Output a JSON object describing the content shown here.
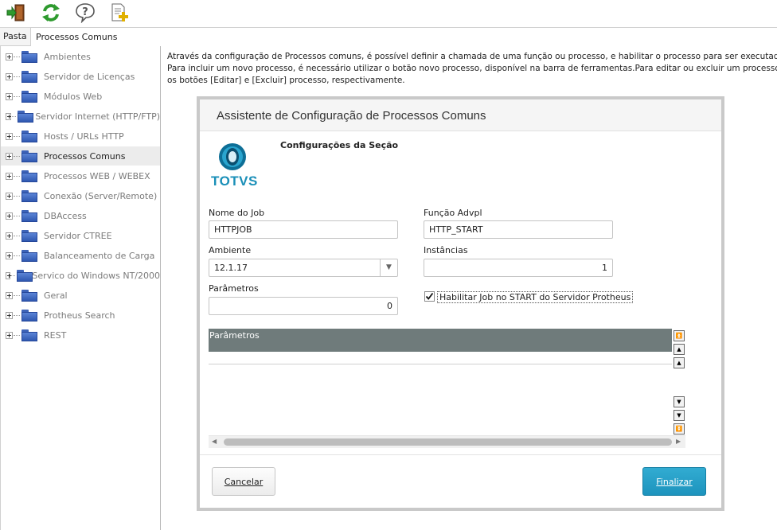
{
  "toolbar": {
    "buttons": [
      {
        "name": "exit-icon",
        "color": "#8b4a1e"
      },
      {
        "name": "refresh-icon",
        "color": "#2e9a2e"
      },
      {
        "name": "help-icon",
        "color": "#555555"
      },
      {
        "name": "new-document-icon",
        "color": "#e0b000"
      }
    ]
  },
  "tabs": {
    "pasta": "Pasta",
    "active": "Processos Comuns"
  },
  "sidebar": {
    "items": [
      {
        "label": "Ambientes",
        "selected": false
      },
      {
        "label": "Servidor de Licenças",
        "selected": false
      },
      {
        "label": "Módulos Web",
        "selected": false
      },
      {
        "label": "Servidor Internet (HTTP/FTP)",
        "selected": false
      },
      {
        "label": "Hosts / URLs HTTP",
        "selected": false
      },
      {
        "label": "Processos Comuns",
        "selected": true
      },
      {
        "label": "Processos WEB / WEBEX",
        "selected": false
      },
      {
        "label": "Conexão (Server/Remote)",
        "selected": false
      },
      {
        "label": "DBAccess",
        "selected": false
      },
      {
        "label": "Servidor CTREE",
        "selected": false
      },
      {
        "label": "Balanceamento de Carga",
        "selected": false
      },
      {
        "label": "Servico do Windows NT/2000",
        "selected": false
      },
      {
        "label": "Geral",
        "selected": false
      },
      {
        "label": "Protheus Search",
        "selected": false
      },
      {
        "label": "REST",
        "selected": false
      }
    ]
  },
  "description": {
    "line1": "Através da configuração de Processos comuns, é possível definir a chamada de uma função ou processo, e habilitar o processo para ser executada durante",
    "line2": "Para incluir um novo processo, é necessário utilizar o botão novo processo, disponível na barra de ferramentas.Para editar ou excluir um processo, é necessá",
    "line3": "os botões [Editar] e [Excluir] processo, respectivamente."
  },
  "dialog": {
    "title": "Assistente de Configuração de Processos Comuns",
    "logo_text": "TOTVS",
    "section_title": "Configurações da Seção",
    "fields": {
      "job_name_label": "Nome do Job",
      "job_name_value": "HTTPJOB",
      "function_label": "Função Advpl",
      "function_value": "HTTP_START",
      "environment_label": "Ambiente",
      "environment_value": "12.1.17",
      "instances_label": "Instâncias",
      "instances_value": "1",
      "params_label": "Parâmetros",
      "params_value": "0"
    },
    "checkbox": {
      "label": "Habilitar Job no START do Servidor Protheus",
      "checked": true
    },
    "grid": {
      "header": "Parâmetros"
    },
    "buttons": {
      "cancel": "Cancelar",
      "finish": "Finalizar"
    }
  }
}
